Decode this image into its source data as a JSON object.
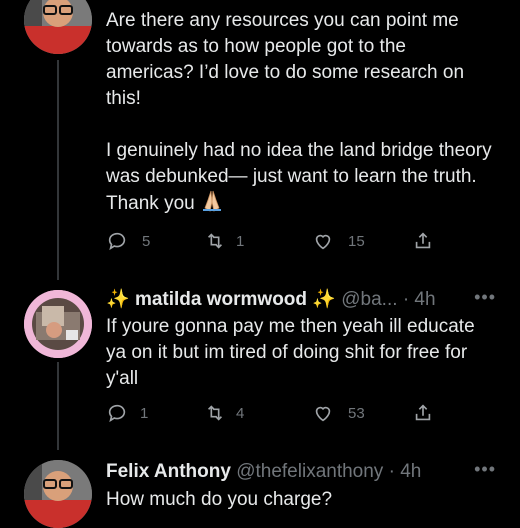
{
  "tweet1": {
    "text_p1": "Are there any resources you can point me towards as to how people got to the americas? I’d love to do some research on this!",
    "text_p2": "I genuinely had no idea the land bridge theory was debunked— just want to learn the truth. Thank you",
    "reply_count": "5",
    "retweet_count": "1",
    "like_count": "15"
  },
  "tweet2": {
    "sparkle_left": "✨",
    "name": "matilda wormwood",
    "sparkle_right": "✨",
    "handle": "@ba...",
    "time": "· 4h",
    "text": "If youre gonna pay me then yeah ill educate ya on it but im tired of doing shit for free for y'all",
    "reply_count": "1",
    "retweet_count": "4",
    "like_count": "53"
  },
  "tweet3": {
    "name": "Felix Anthony",
    "handle": "@thefelixanthony",
    "time": "· 4h",
    "text": "How much do you charge?"
  },
  "more_glyph": "•••",
  "colors": {
    "background": "#000000",
    "text": "#e7e9ea",
    "muted": "#71767b",
    "sparkle": "#f5c518"
  }
}
